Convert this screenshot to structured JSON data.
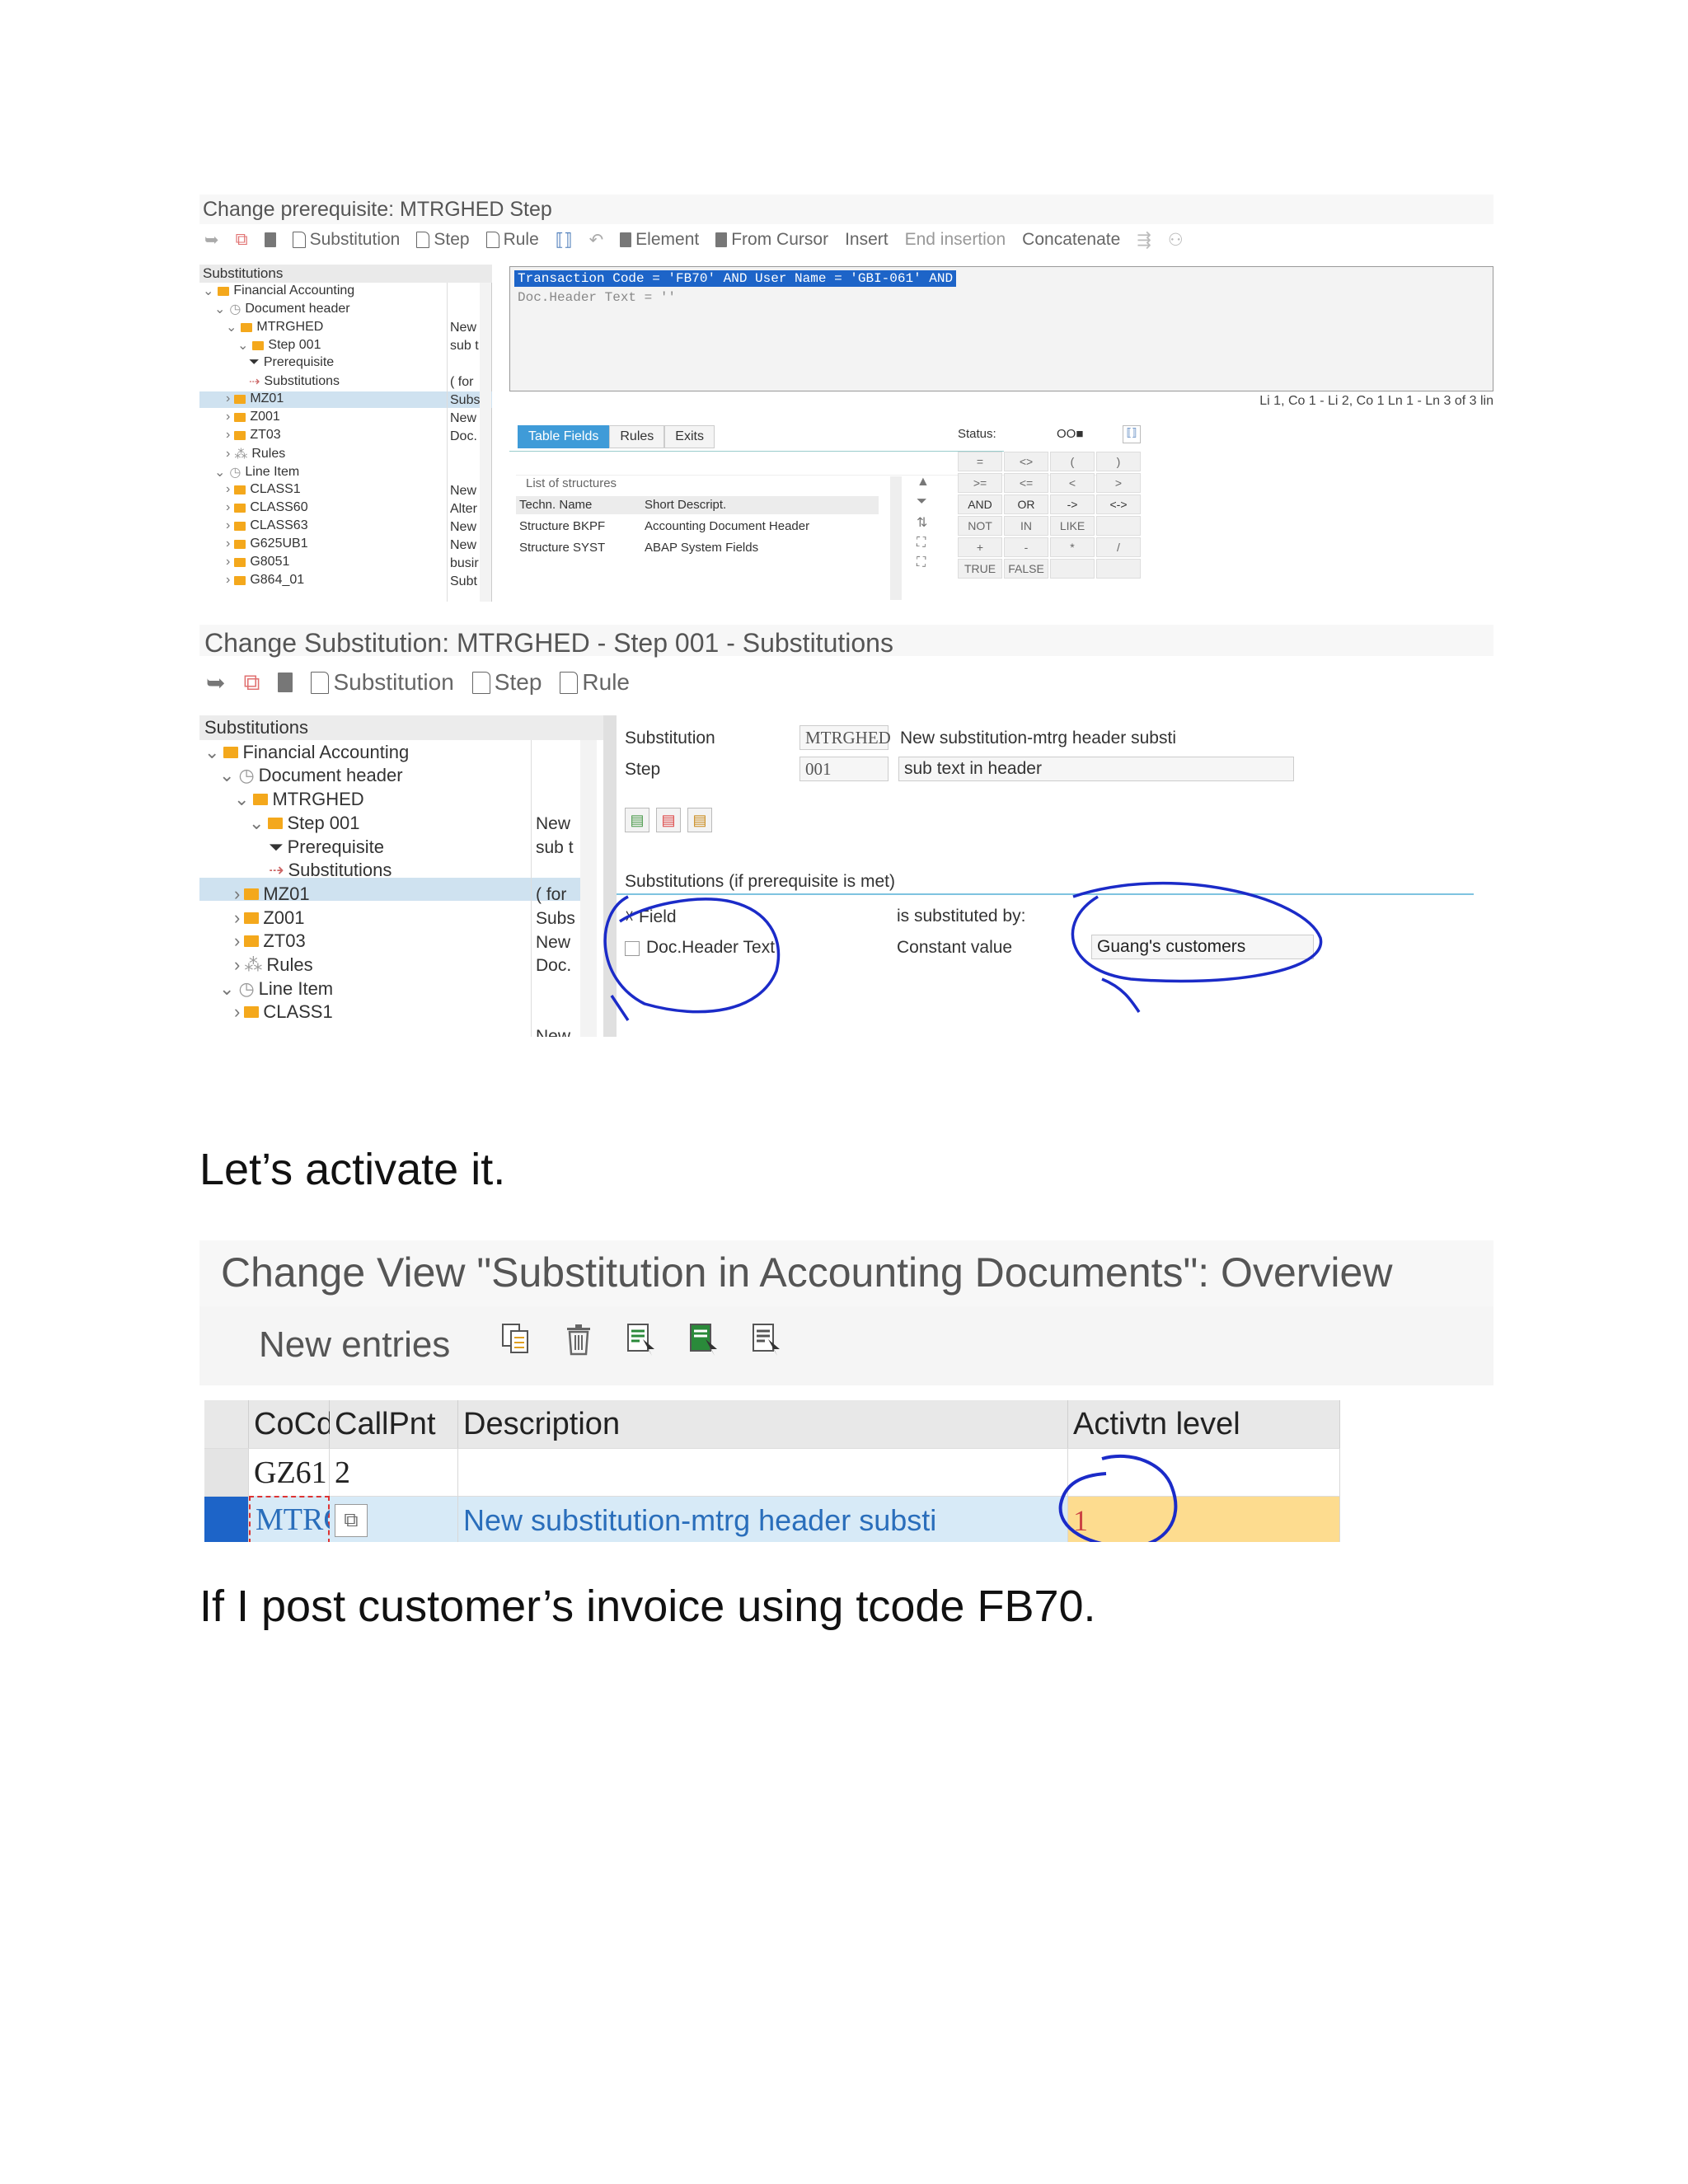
{
  "screen1": {
    "title": "Change prerequisite: MTRGHED Step",
    "toolbar": {
      "substitution": "Substitution",
      "step": "Step",
      "rule": "Rule",
      "element": "Element",
      "from_cursor": "From Cursor",
      "insert": "Insert",
      "end_insertion": "End insertion",
      "concatenate": "Concatenate"
    },
    "tree": {
      "header": "Substitutions",
      "items": [
        "Financial Accounting",
        "Document header",
        "MTRGHED",
        "Step 001",
        "Prerequisite",
        "Substitutions",
        "MZ01",
        "Z001",
        "ZT03",
        "Rules",
        "Line Item",
        "CLASS1",
        "CLASS60",
        "CLASS63",
        "G625UB1",
        "G8051",
        "G864_01"
      ],
      "col2": [
        "New",
        "sub t",
        "( for",
        "Subs",
        "New",
        "Doc.",
        "New",
        "Alter",
        "New",
        "New",
        "busir",
        "Subt"
      ]
    },
    "editor": {
      "line1": "Transaction Code = 'FB70' AND User Name = 'GBI-061' AND",
      "line2": "Doc.Header Text = ''"
    },
    "position": "Li 1, Co 1 - Li 2, Co 1  Ln 1 - Ln 3 of 3 lin",
    "tabs": [
      "Table Fields",
      "Rules",
      "Exits"
    ],
    "list": {
      "title": "List of structures",
      "col1": "Techn. Name",
      "col2": "Short Descript.",
      "rows": [
        {
          "name": "Structure BKPF",
          "desc": "Accounting Document Header"
        },
        {
          "name": "Structure SYST",
          "desc": "ABAP System Fields"
        }
      ]
    },
    "status": {
      "label": "Status:",
      "value": "OO■",
      "ops": [
        "=",
        "<>",
        "(",
        ")",
        ">=",
        "<=",
        "<",
        ">",
        "AND",
        "OR",
        "->",
        "<->",
        "NOT",
        "IN",
        "LIKE",
        "",
        "+",
        "-",
        "*",
        "/",
        "TRUE",
        "FALSE",
        "",
        ""
      ]
    }
  },
  "screen2": {
    "title": "Change Substitution: MTRGHED - Step 001 - Substitutions",
    "toolbar": {
      "substitution": "Substitution",
      "step": "Step",
      "rule": "Rule"
    },
    "tree": {
      "header": "Substitutions",
      "items": [
        "Financial Accounting",
        "Document header",
        "MTRGHED",
        "Step 001",
        "Prerequisite",
        "Substitutions",
        "MZ01",
        "Z001",
        "ZT03",
        "Rules",
        "Line Item",
        "CLASS1"
      ],
      "col2": [
        "New",
        "sub t",
        "( for",
        "Subs",
        "New",
        "Doc.",
        "New"
      ]
    },
    "form": {
      "substitution_label": "Substitution",
      "substitution_value": "MTRGHED",
      "substitution_desc": "New substitution-mtrg header substi",
      "step_label": "Step",
      "step_value": "001",
      "step_desc": "sub text in header"
    },
    "subs": {
      "title": "Substitutions (if prerequisite is met)",
      "field_head": "Field",
      "field_value": "Doc.Header Text",
      "by_head": "is substituted by:",
      "method": "Constant value",
      "constant": "Guang's customers"
    }
  },
  "text1": "Let’s activate it.",
  "screen3": {
    "title": "Change View \"Substitution in Accounting Documents\": Overview",
    "new_entries": "New entries",
    "columns": [
      "CoCd",
      "CallPnt",
      "Description",
      "Activtn level"
    ],
    "rows": [
      {
        "cocd": "GZ61",
        "callpnt": "2",
        "description": "",
        "level": ""
      },
      {
        "cocd": "MTRG",
        "callpnt": "",
        "description": "New substitution-mtrg header substi",
        "level": "1"
      }
    ]
  },
  "text2": "If I post customer’s invoice using tcode FB70.",
  "colors": {
    "accent": "#1d64c8",
    "ink": "#1b2bc8",
    "folder": "#f4a81c",
    "highlight": "#fddc8f"
  }
}
